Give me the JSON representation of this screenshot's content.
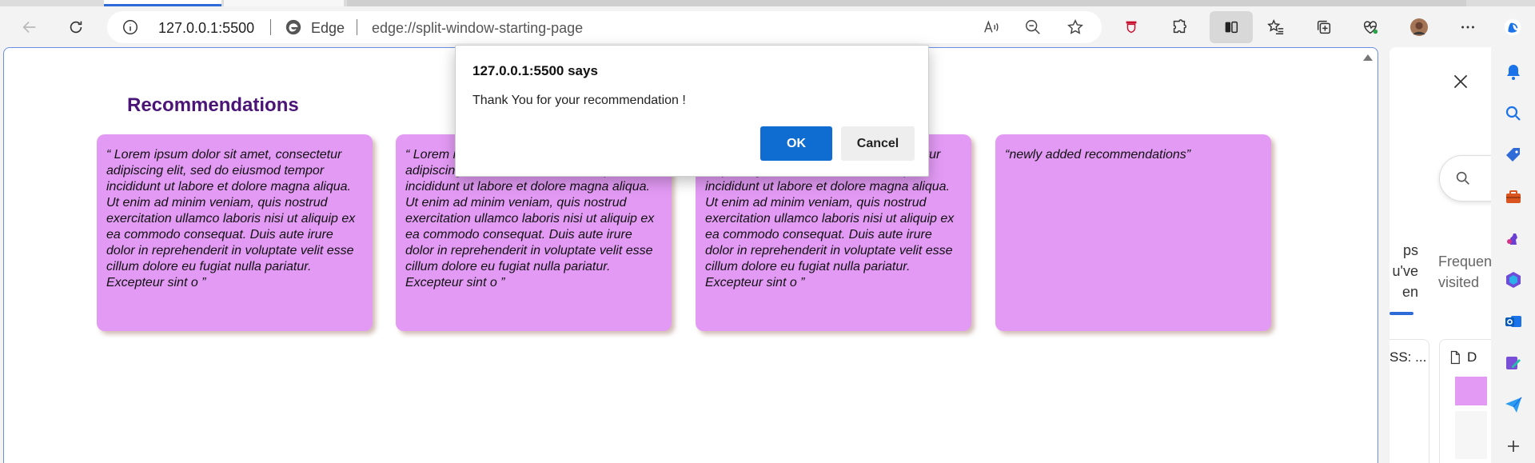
{
  "toolbar": {
    "address_host": "127.0.0.1:5500",
    "edge_label": "Edge",
    "address_url": "edge://split-window-starting-page"
  },
  "page": {
    "title": "Recommendations",
    "cards": [
      {
        "text": "“ Lorem ipsum dolor sit amet, consectetur adipiscing elit, sed do eiusmod tempor incididunt ut labore et dolore magna aliqua. Ut enim ad minim veniam, quis nostrud exercitation ullamco laboris nisi ut aliquip ex ea commodo consequat. Duis aute irure dolor in reprehenderit in voluptate velit esse cillum dolore eu fugiat nulla pariatur. Excepteur sint o ”"
      },
      {
        "text": "“ Lorem ipsum dolor sit amet, consectetur adipiscing elit, sed do eiusmod tempor incididunt ut labore et dolore magna aliqua. Ut enim ad minim veniam, quis nostrud exercitation ullamco laboris nisi ut aliquip ex ea commodo consequat. Duis aute irure dolor in reprehenderit in voluptate velit esse cillum dolore eu fugiat nulla pariatur. Excepteur sint o ”"
      },
      {
        "text": "“ Lorem ipsum dolor sit amet, consectetur adipiscing elit, sed do eiusmod tempor incididunt ut labore et dolore magna aliqua. Ut enim ad minim veniam, quis nostrud exercitation ullamco laboris nisi ut aliquip ex ea commodo consequat. Duis aute irure dolor in reprehenderit in voluptate velit esse cillum dolore eu fugiat nulla pariatur. Excepteur sint o ”"
      },
      {
        "text": "“newly added recommendations”"
      }
    ],
    "card_color": "#e29af4",
    "title_color": "#4b1578"
  },
  "dialog": {
    "title": "127.0.0.1:5500 says",
    "message": "Thank You for your recommendation !",
    "ok_label": "OK",
    "cancel_label": "Cancel",
    "ok_color": "#0f6cd1"
  },
  "split_pane": {
    "tab1_line1": "ps",
    "tab1_line2": "u've",
    "tab1_line3": "en",
    "tab2_line1": "Frequently",
    "tab2_line2": "visited",
    "card1_text": "SS: ...",
    "card2_text": "D"
  },
  "icons": {
    "back": "back-arrow-icon",
    "refresh": "refresh-icon",
    "info": "info-icon",
    "read_aloud": "read-aloud-icon",
    "zoom_out": "zoom-out-icon",
    "favorite": "star-icon",
    "extensions": "puzzle-icon",
    "split_screen": "split-screen-icon",
    "favorites": "favorites-icon",
    "collections": "collections-icon",
    "browser_essentials": "heart-pulse-icon",
    "more": "more-icon",
    "copilot": "copilot-icon"
  }
}
